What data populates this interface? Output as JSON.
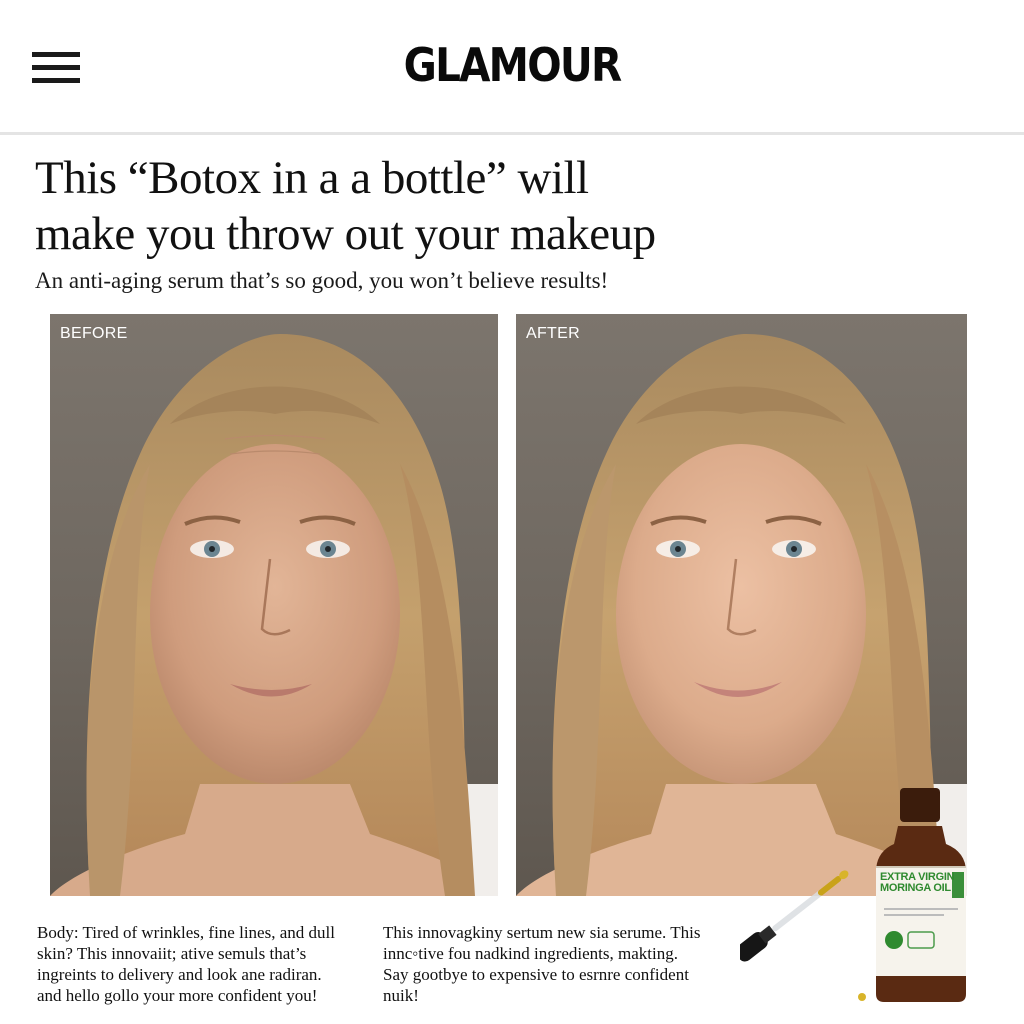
{
  "header": {
    "logo": "GLAMOUR",
    "menu_icon": "hamburger-menu-icon"
  },
  "article": {
    "headline_lines": [
      "This “Botox in a a bottle” will",
      "make you throw out your makeup"
    ],
    "dek": "An anti-aging serum that’s so good, you won’t believe results!",
    "before_label": "BEFORE",
    "after_label": "AFTER",
    "body_left_lines": [
      "Body: Tired of wrinkles, fine lines, and dull",
      "skin? This innovaiit; ative semuls that’s",
      "ingreints to delivery and look ane radiran.",
      "and hello gollo your more confident you!"
    ],
    "body_right_lines": [
      "This innovagkiny sertum new sia serume. This",
      "innc◦tive fou nadkind ingredients, makting.",
      "Say gootbye to expensive to esrnre confident",
      "nuik!"
    ]
  },
  "product": {
    "label_lines": [
      "EXTRA VIRGIN",
      "MORINGA OIL"
    ],
    "label_color": "#2f8a2f",
    "bottle_color": "#5a2a12"
  },
  "colors": {
    "photo_background": "#766f67",
    "text": "#111111",
    "divider": "#e4e4e4"
  }
}
